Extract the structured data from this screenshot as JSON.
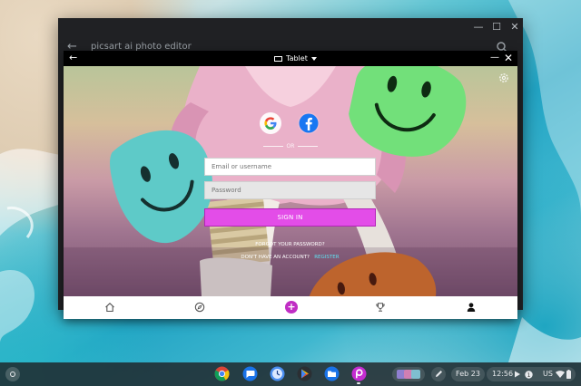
{
  "outer_window": {
    "title": "picsart ai photo editor",
    "controls": {
      "minimize_icon": "minimize-icon",
      "maximize_icon": "maximize-icon",
      "close_icon": "close-icon"
    },
    "back_icon": "back-arrow-icon",
    "search_icon": "search-icon"
  },
  "inner_window": {
    "back_icon": "back-arrow-icon",
    "display_mode": "Tablet",
    "minimize_glyph": "—",
    "close_glyph": "✕"
  },
  "login": {
    "social": [
      {
        "name": "Google",
        "icon": "google-icon"
      },
      {
        "name": "Facebook",
        "icon": "facebook-icon"
      }
    ],
    "divider_text": "OR",
    "email_placeholder": "Email or username",
    "password_placeholder": "Password",
    "signin_label": "SIGN IN",
    "forgot_label": "FORGOT YOUR PASSWORD?",
    "no_account_text": "DON'T HAVE AN ACCOUNT?",
    "register_label": "REGISTER",
    "settings_icon": "gear-icon"
  },
  "bottom_nav": {
    "items": [
      {
        "name": "home",
        "icon": "home-icon"
      },
      {
        "name": "discover",
        "icon": "compass-icon"
      },
      {
        "name": "create",
        "icon": "plus-icon",
        "glyph": "+"
      },
      {
        "name": "challenges",
        "icon": "trophy-icon"
      },
      {
        "name": "profile",
        "icon": "person-icon"
      }
    ],
    "accent_color": "#c02ec4"
  },
  "shelf": {
    "apps": [
      "chrome-icon",
      "messages-icon",
      "clock-icon",
      "play-store-icon",
      "files-icon",
      "picsart-icon"
    ],
    "date": "Feb 23",
    "time": "12:56",
    "ime": "US",
    "status_icons": [
      "play-icon",
      "notification-icon",
      "wifi-icon",
      "battery-icon"
    ]
  },
  "colors": {
    "signin_button": "#e34de8",
    "register_link": "#5fe0f0"
  }
}
